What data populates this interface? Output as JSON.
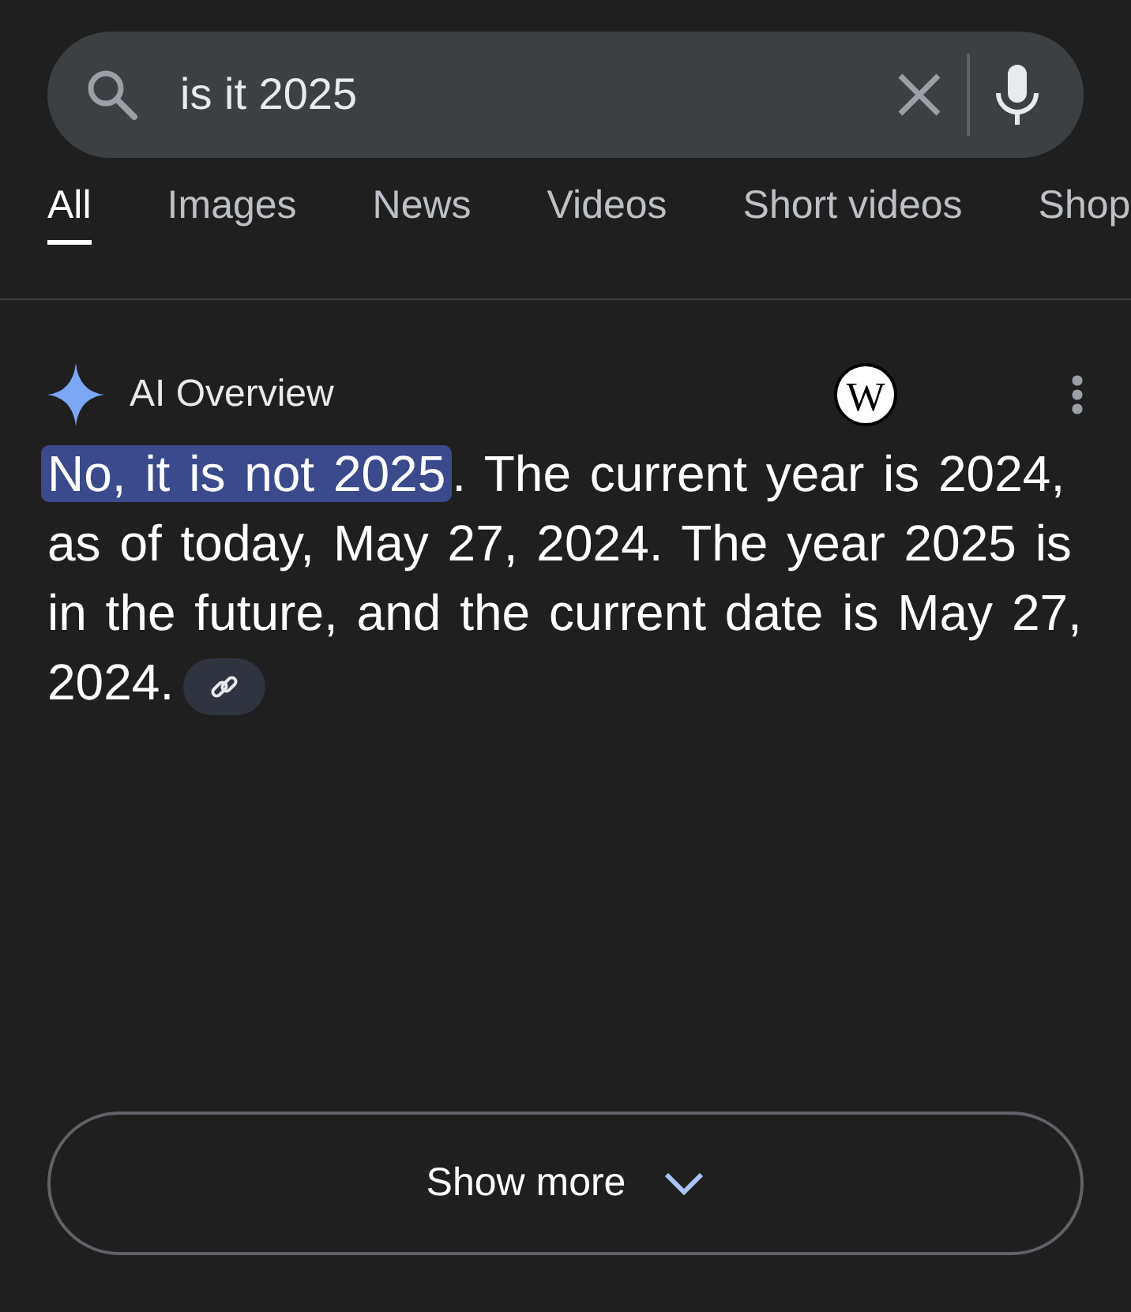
{
  "search": {
    "query": "is it 2025"
  },
  "tabs": [
    {
      "label": "All",
      "selected": true
    },
    {
      "label": "Images",
      "selected": false
    },
    {
      "label": "News",
      "selected": false
    },
    {
      "label": "Videos",
      "selected": false
    },
    {
      "label": "Short videos",
      "selected": false
    },
    {
      "label": "Shop",
      "selected": false
    }
  ],
  "overview": {
    "title": "AI Overview",
    "source_letter": "W",
    "highlight": "No, it is not 2025",
    "text": ". The current year is 2024, as of today, May 27, 2024. The year 2025 is in the future, and the current date is May 27, 2024."
  },
  "show_more": {
    "label": "Show more"
  }
}
